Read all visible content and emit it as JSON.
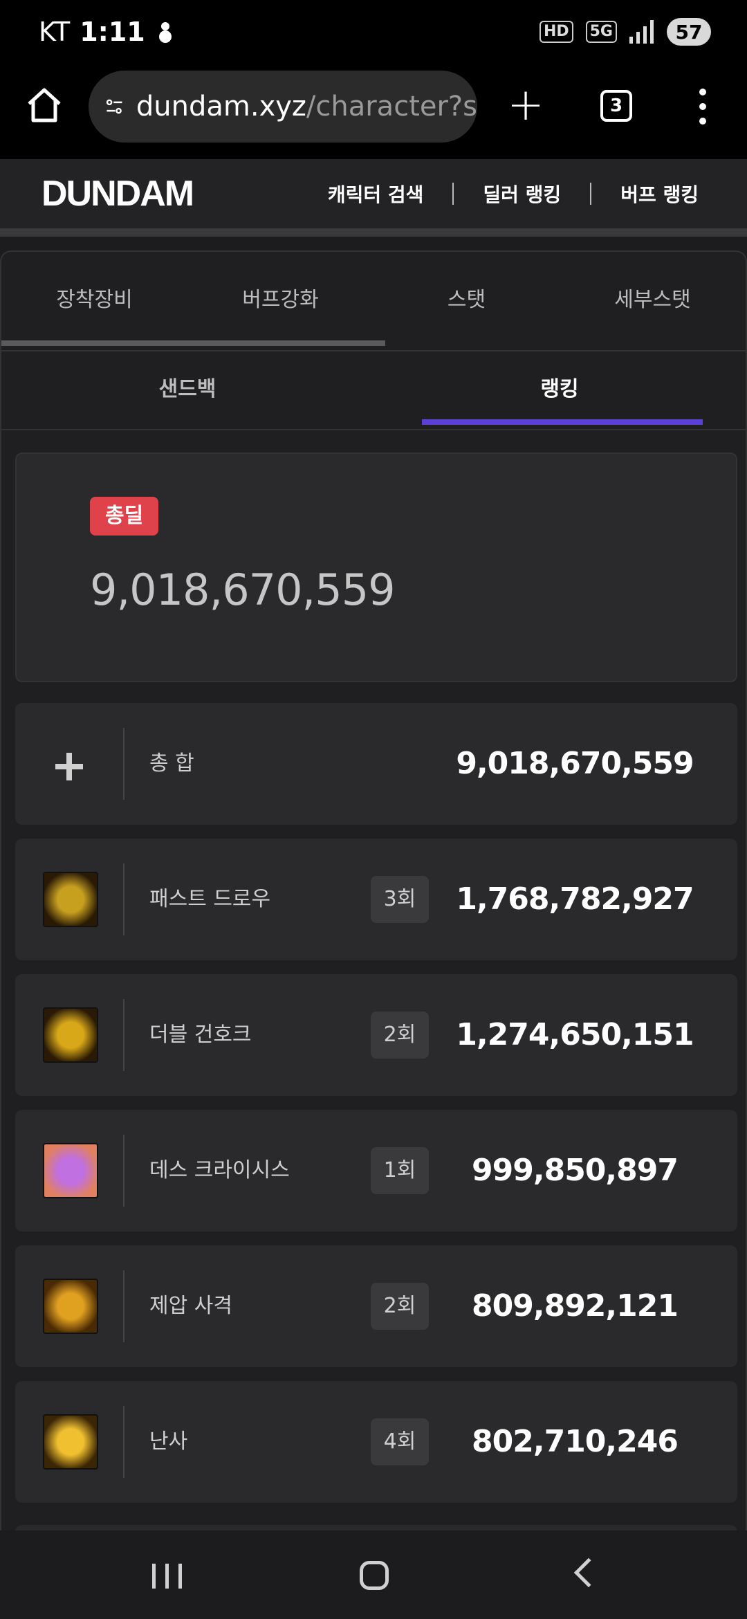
{
  "status_bar": {
    "carrier": "KT",
    "time": "1:11",
    "battery": "57",
    "icons": [
      "snowman-icon",
      "hd-icon",
      "5g-icon",
      "signal-icon",
      "battery-icon"
    ]
  },
  "browser": {
    "url_host": "dundam.xyz",
    "url_path": "/character?s",
    "tab_count": "3"
  },
  "site": {
    "logo": "DUNDAM",
    "nav": [
      "캐릭터 검색",
      "딜러 랭킹",
      "버프 랭킹"
    ]
  },
  "top_tabs": [
    "장착장비",
    "버프강화",
    "스탯",
    "세부스탯"
  ],
  "sub_tabs": [
    "샌드백",
    "랭킹"
  ],
  "total": {
    "badge": "총딜",
    "value": "9,018,670,559"
  },
  "summary_row": {
    "name": "총 합",
    "value": "9,018,670,559"
  },
  "skills": [
    {
      "name": "패스트 드로우",
      "count": "3회",
      "value": "1,768,782,927",
      "colors": [
        "#c8a020",
        "#2a1a05"
      ]
    },
    {
      "name": "더블 건호크",
      "count": "2회",
      "value": "1,274,650,151",
      "colors": [
        "#d8a818",
        "#2a1a05"
      ]
    },
    {
      "name": "데스 크라이시스",
      "count": "1회",
      "value": "999,850,897",
      "colors": [
        "#c070e0",
        "#e08060"
      ]
    },
    {
      "name": "제압 사격",
      "count": "2회",
      "value": "809,892,121",
      "colors": [
        "#e0a020",
        "#4a2a05"
      ]
    },
    {
      "name": "난사",
      "count": "4회",
      "value": "802,710,246",
      "colors": [
        "#f0c030",
        "#3a2505"
      ]
    }
  ]
}
